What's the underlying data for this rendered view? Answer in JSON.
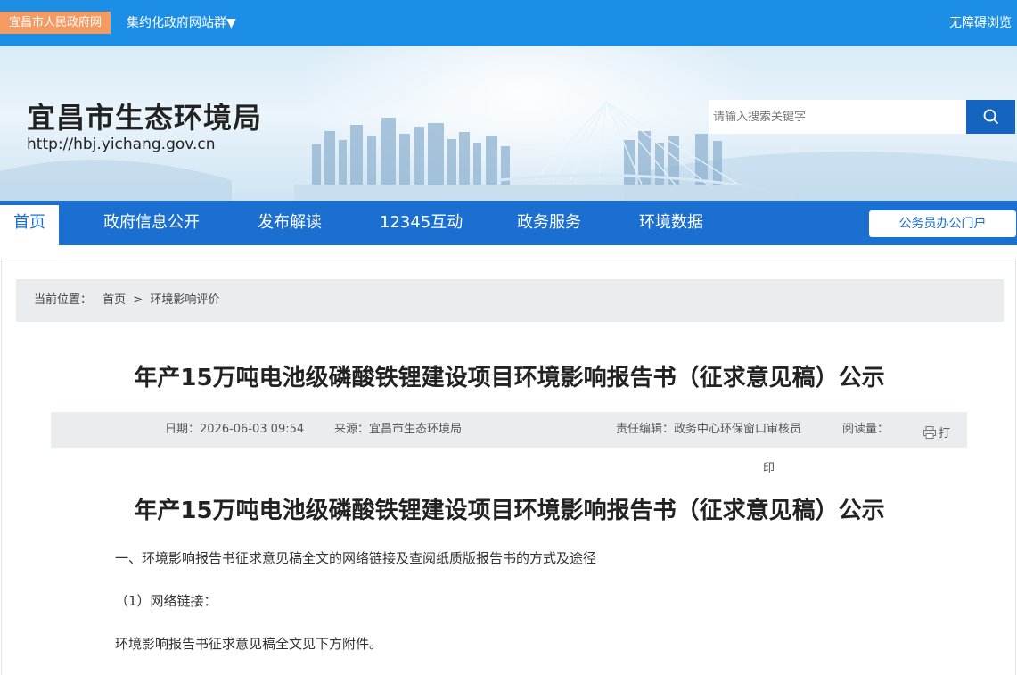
{
  "topbar": {
    "gov_link": "宜昌市人民政府网",
    "site_group": "集约化政府网站群▼",
    "accessibility": "无障碍浏览"
  },
  "banner": {
    "site_name": "宜昌市生态环境局",
    "site_url": "http://hbj.yichang.gov.cn",
    "search_placeholder": "请输入搜索关键字"
  },
  "nav": {
    "items": [
      "首页",
      "政府信息公开",
      "发布解读",
      "12345互动",
      "政务服务",
      "环境数据"
    ],
    "active_index": 0,
    "portal_button": "公务员办公门户"
  },
  "breadcrumb": {
    "prefix": "当前位置：",
    "home": "首页",
    "separator": ">",
    "current": "环境影响评价"
  },
  "article": {
    "title": "年产15万吨电池级磷酸铁锂建设项目环境影响报告书（征求意见稿）公示",
    "body_title": "年产15万吨电池级磷酸铁锂建设项目环境影响报告书（征求意见稿）公示",
    "meta": {
      "date": "日期：2026-06-03 09:54",
      "source": "来源：宜昌市生态环境局",
      "editor": "责任编辑：政务中心环保窗口审核员",
      "views": "阅读量：",
      "print_label_1": "打",
      "print_label_2": "印"
    },
    "paragraphs": [
      "一、环境影响报告书征求意见稿全文的网络链接及查阅纸质版报告书的方式及途径",
      "（1）网络链接：",
      "环境影响报告书征求意见稿全文见下方附件。"
    ]
  },
  "colors": {
    "topbar": "#1d8ee6",
    "nav": "#1b6fd1",
    "gov_link_bg": "#f49a63",
    "search_button": "#1565c0"
  }
}
